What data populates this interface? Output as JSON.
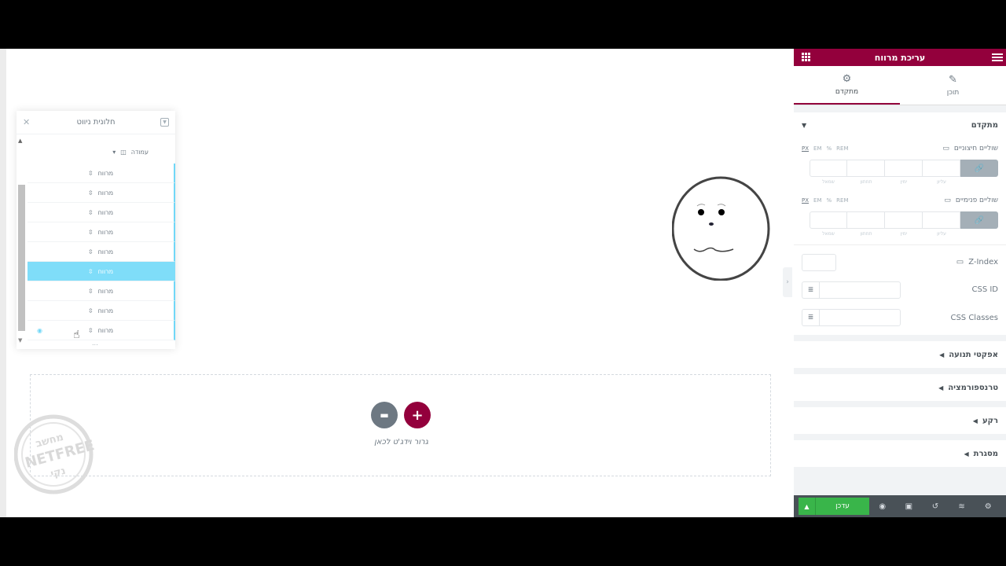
{
  "panel": {
    "title": "עריכת מרווח",
    "tabs": [
      {
        "label": "תוכן",
        "icon": "pencil-icon"
      },
      {
        "label": "מתקדם",
        "icon": "gear-icon"
      }
    ],
    "advanced_section": {
      "title": "מתקדם",
      "margin": {
        "label": "שוליים חיצוניים",
        "units": [
          "PX",
          "EM",
          "%",
          "REM"
        ],
        "selected_unit": "PX",
        "sides": [
          "עליון",
          "ימין",
          "תחתון",
          "שמאל"
        ]
      },
      "padding": {
        "label": "שוליים פנימיים",
        "units": [
          "PX",
          "EM",
          "%",
          "REM"
        ],
        "selected_unit": "PX",
        "sides": [
          "עליון",
          "ימין",
          "תחתון",
          "שמאל"
        ]
      },
      "z_index_label": "Z-Index",
      "css_id_label": "CSS ID",
      "css_classes_label": "CSS Classes"
    },
    "collapsed_sections": [
      "אפקטי תנועה",
      "טרנספורמציה",
      "רקע",
      "מסגרת"
    ],
    "footer": {
      "publish_label": "עדכן"
    }
  },
  "navigator": {
    "title": "חלונית ניווט",
    "column_label": "עמודה",
    "items": [
      "מרווח",
      "מרווח",
      "מרווח",
      "מרווח",
      "מרווח",
      "מרווח",
      "מרווח",
      "מרווח",
      "מרווח"
    ],
    "selected_index": 5,
    "more": "..."
  },
  "canvas": {
    "drop_text": "גרור וידג'ט לכאן"
  },
  "watermark": {
    "top": "מחשב",
    "middle": "NETFREE",
    "bottom": "נקי"
  },
  "colors": {
    "brand": "#93003c",
    "publish": "#39b54a",
    "selected": "#7fddf9"
  }
}
